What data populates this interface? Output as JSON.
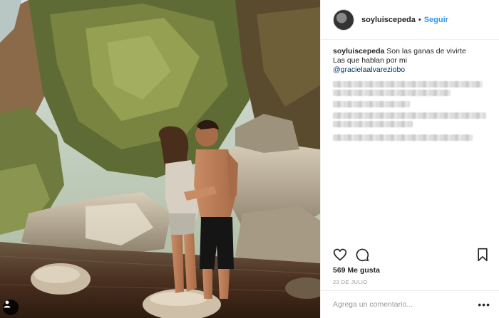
{
  "post": {
    "username": "soyluiscepeda",
    "separator": "•",
    "follow_label": "Seguir",
    "caption_line1": "Son las ganas de vivirte",
    "caption_line2": "Las que hablan por mi",
    "mention": "@gracielaalvareziobo",
    "likes": "569 Me gusta",
    "date": "23 DE JULIO",
    "comment_placeholder": "Agrega un comentario...",
    "more_label": "•••"
  },
  "icons": {
    "like": "heart-icon",
    "comment": "comment-bubble-icon",
    "save": "bookmark-icon",
    "photo_user": "person-icon"
  },
  "colors": {
    "link": "#3897f0",
    "mention": "#003569",
    "text": "#262626",
    "muted": "#999999",
    "border": "#efefef"
  }
}
